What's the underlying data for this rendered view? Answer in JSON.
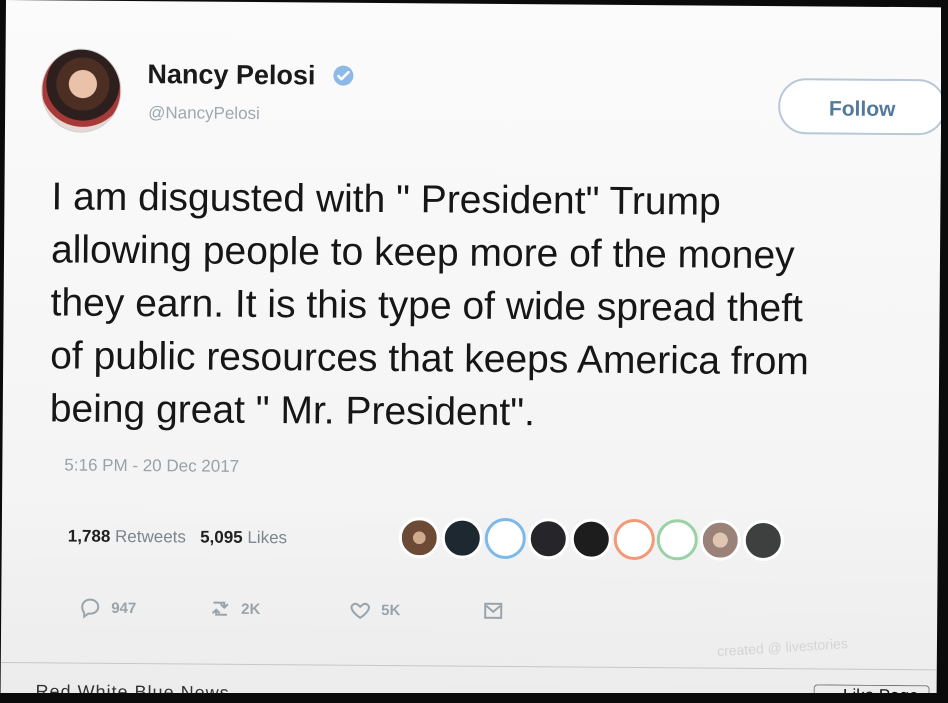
{
  "tweet": {
    "author_name": "Nancy Pelosi",
    "handle": "@NancyPelosi",
    "follow_label": "Follow",
    "lines": [
      "I am disgusted with \" President\" Trump",
      "allowing people to keep more of the money",
      "they earn.  It is this type of wide spread theft",
      "of public resources that keeps America from",
      "being great \" Mr. President\"."
    ],
    "timestamp": "5:16 PM - 20 Dec 2017"
  },
  "stats": {
    "retweets": "1,788",
    "retweets_label": "Retweets",
    "likes": "5,095",
    "likes_label": "Likes"
  },
  "actions": {
    "replies": "947",
    "retweets": "2K",
    "likes": "5K"
  },
  "watermark": {
    "text": "created @ livestories"
  },
  "footer": {
    "partial_text": "Red White Blue News",
    "like_page_label": "Like Page"
  },
  "icons": {
    "verified": "verified-badge-icon",
    "reply": "reply-icon",
    "retweet": "retweet-icon",
    "like": "heart-icon",
    "message": "envelope-icon"
  },
  "colors": {
    "follow_text": "#537a9b",
    "verified": "#8db9e6",
    "muted": "#9aa3aa"
  }
}
